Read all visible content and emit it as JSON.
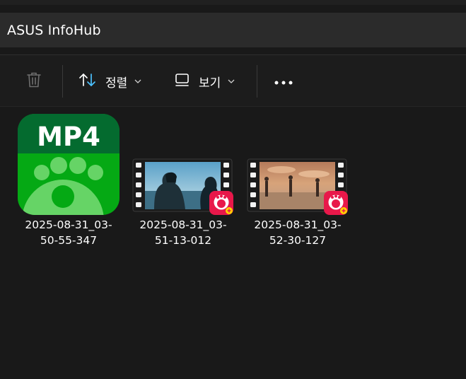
{
  "window": {
    "address_title": "ASUS InfoHub"
  },
  "toolbar": {
    "delete_icon": "trash-icon",
    "sort_label": "정렬",
    "sort_icon": "sort-arrows-icon",
    "view_label": "보기",
    "view_icon": "view-monitor-icon",
    "more_icon": "more-dots-icon"
  },
  "files": [
    {
      "name_line1": "2025-08-31_03-",
      "name_line2": "50-55-347",
      "icon": "mp4-file-icon",
      "icon_badge_text": "MP4"
    },
    {
      "name_line1": "2025-08-31_03-",
      "name_line2": "51-13-012",
      "icon": "video-thumbnail"
    },
    {
      "name_line1": "2025-08-31_03-",
      "name_line2": "52-30-127",
      "icon": "video-thumbnail"
    }
  ],
  "colors": {
    "background": "#191919",
    "toolbar": "#1c1c1c",
    "address_bar": "#2b2b2b",
    "mp4_green": "#05a914",
    "mp4_dark_green": "#046b2f",
    "player_badge": "#e8184a",
    "sort_accent": "#4cc2ff"
  }
}
